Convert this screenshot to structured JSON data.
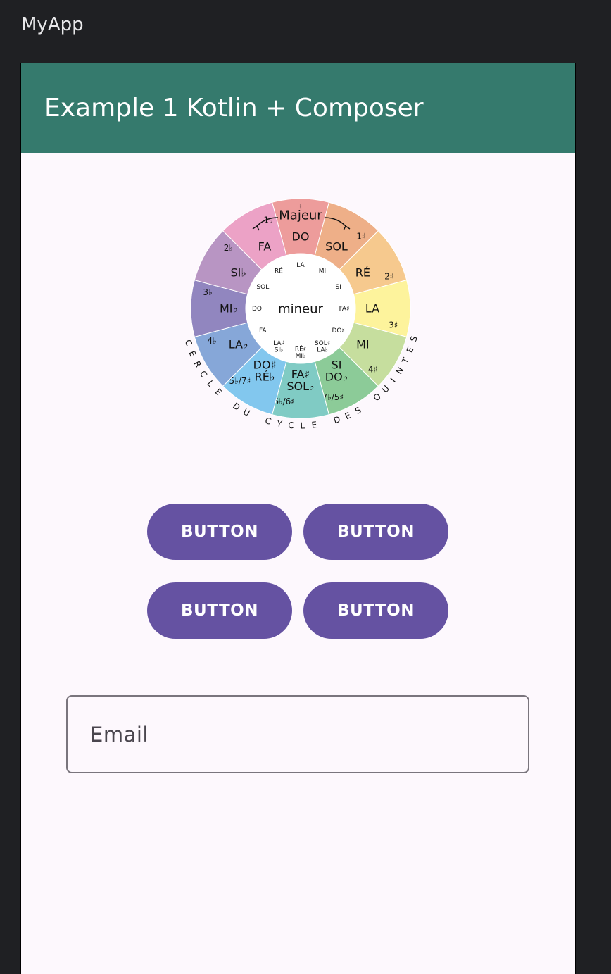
{
  "window": {
    "title": "MyApp"
  },
  "appbar": {
    "title": "Example 1 Kotlin + Composer"
  },
  "circle_of_fifths": {
    "center_label": "mineur",
    "top_label": "Majeur",
    "natural_sign": "♮",
    "outer_arc_text": "CERCLE DU CYCLE DES QUINTES",
    "segments": [
      {
        "major": "DO",
        "signature": "",
        "color": "#ed9c9b"
      },
      {
        "major": "SOL",
        "signature": "1♯",
        "color": "#eeaf88"
      },
      {
        "major": "RÉ",
        "signature": "2♯",
        "color": "#f6c98e"
      },
      {
        "major": "LA",
        "signature": "3♯",
        "color": "#fdf39c"
      },
      {
        "major": "MI",
        "signature": "4♯",
        "color": "#c6de9e"
      },
      {
        "major": "SI\nDO♭",
        "signature": "7♭/5♯",
        "color": "#8ccb98"
      },
      {
        "major": "FA♯\nSOL♭",
        "signature": "6♭/6♯",
        "color": "#80cbc4"
      },
      {
        "major": "DO♯\nRÉ♭",
        "signature": "5♭/7♯",
        "color": "#82c7ee"
      },
      {
        "major": "LA♭",
        "signature": "4♭",
        "color": "#86a7d8"
      },
      {
        "major": "MI♭",
        "signature": "3♭",
        "color": "#9186bf"
      },
      {
        "major": "SI♭",
        "signature": "2♭",
        "color": "#b895c3"
      },
      {
        "major": "FA",
        "signature": "1♭",
        "color": "#eca2c6"
      }
    ],
    "minor_keys": [
      "LA",
      "MI",
      "SI",
      "FA♯",
      "DO♯",
      "SOL♯\nLA♭",
      "RÉ♯\nMI♭",
      "LA♯\nSI♭",
      "FA",
      "DO",
      "SOL",
      "RÉ"
    ]
  },
  "buttons": [
    {
      "label": "BUTTON"
    },
    {
      "label": "BUTTON"
    },
    {
      "label": "BUTTON"
    },
    {
      "label": "BUTTON"
    }
  ],
  "email_field": {
    "placeholder": "Email",
    "value": ""
  },
  "colors": {
    "window_bg": "#1f2023",
    "appbar": "#357a6d",
    "surface": "#fdf8fd",
    "button": "#6552a2",
    "outline": "#7a757d"
  }
}
